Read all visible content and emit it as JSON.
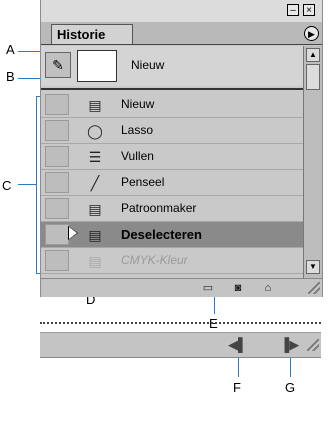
{
  "callouts": {
    "a": "A",
    "b": "B",
    "c": "C",
    "d": "D",
    "e": "E",
    "f": "F",
    "g": "G"
  },
  "panel": {
    "title": "Historie",
    "window_buttons": {
      "minimize": "–",
      "close": "×"
    },
    "menu_icon": "menu-arrow-icon",
    "snapshot": {
      "label": "Nieuw",
      "brush_icon": "history-brush-icon"
    },
    "states": [
      {
        "label": "Nieuw",
        "icon": "document-icon",
        "selected": false,
        "dimmed": false
      },
      {
        "label": "Lasso",
        "icon": "lasso-icon",
        "selected": false,
        "dimmed": false
      },
      {
        "label": "Vullen",
        "icon": "fill-icon",
        "selected": false,
        "dimmed": false
      },
      {
        "label": "Penseel",
        "icon": "brush-icon",
        "selected": false,
        "dimmed": false
      },
      {
        "label": "Patroonmaker",
        "icon": "document-icon",
        "selected": false,
        "dimmed": false
      },
      {
        "label": "Deselecteren",
        "icon": "document-icon",
        "selected": true,
        "dimmed": false
      },
      {
        "label": "CMYK-Kleur",
        "icon": "document-icon",
        "selected": false,
        "dimmed": true
      }
    ],
    "bottom_icons": [
      "new-document-icon",
      "camera-icon",
      "trash-icon"
    ]
  },
  "strip": {
    "icons": [
      "step-backward-icon",
      "step-forward-icon"
    ]
  }
}
